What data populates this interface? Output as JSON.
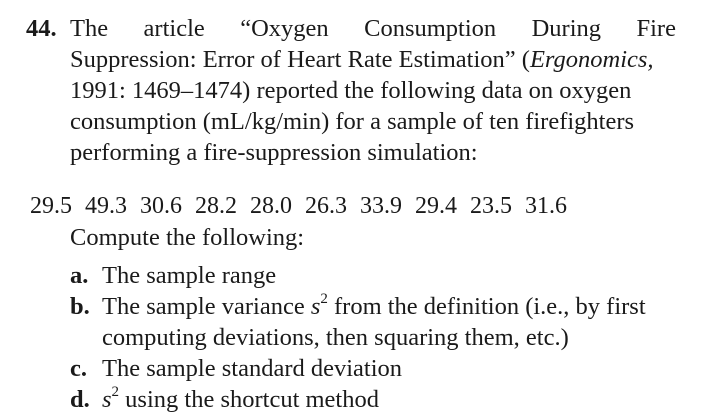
{
  "problem": {
    "number": "44.",
    "intro_lines": [
      [
        "The",
        "article",
        "“Oxygen",
        "Consumption",
        "During",
        "Fire"
      ],
      "Suppression: Error of Heart Rate Estimation” (",
      "1991: 1469–1474) reported the following data on oxygen",
      "consumption (mL/kg/min) for a sample of ten firefighters",
      "performing a fire-suppression simulation:"
    ],
    "journal": "Ergonomics,",
    "data_values": [
      "29.5",
      "49.3",
      "30.6",
      "28.2",
      "28.0",
      "26.3",
      "33.9",
      "29.4",
      "23.5",
      "31.6"
    ],
    "compute_label": "Compute the following:",
    "parts": [
      {
        "letter": "a.",
        "text": "The sample range"
      },
      {
        "letter": "b.",
        "text_before": "The sample variance ",
        "symbol": "s",
        "sup": "2",
        "text_after": " from the definition (i.e., by first",
        "continuation": "computing deviations, then squaring them, etc.)"
      },
      {
        "letter": "c.",
        "text": "The sample standard deviation"
      },
      {
        "letter": "d.",
        "symbol": "s",
        "sup": "2",
        "text_after": " using the shortcut method"
      }
    ]
  }
}
